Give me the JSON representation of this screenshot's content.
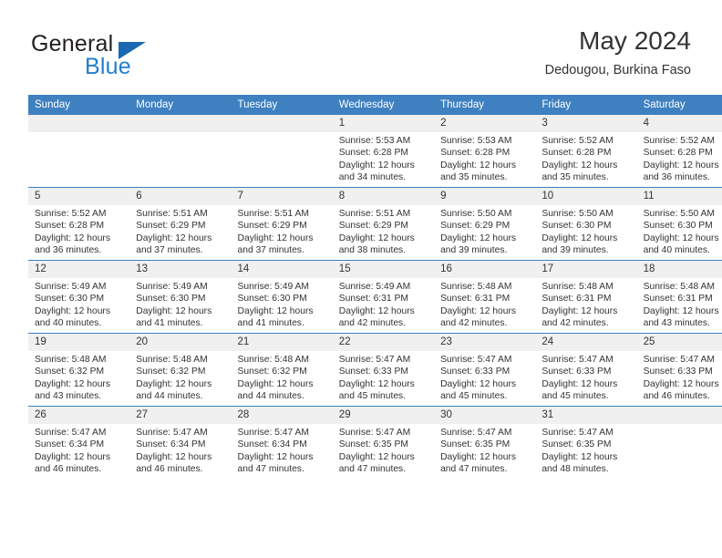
{
  "brand": {
    "name_part1": "General",
    "name_part2": "Blue",
    "triangle_color": "#1b68b3",
    "blue_text_color": "#1f7fd0"
  },
  "header": {
    "title": "May 2024",
    "subtitle": "Dedougou, Burkina Faso"
  },
  "theme": {
    "header_bar_color": "#3f80c0",
    "daynum_strip_color": "#f0f0f0",
    "text_color": "#333333"
  },
  "weekday_headers": [
    "Sunday",
    "Monday",
    "Tuesday",
    "Wednesday",
    "Thursday",
    "Friday",
    "Saturday"
  ],
  "weeks": [
    [
      {
        "day": "",
        "blank": true
      },
      {
        "day": "",
        "blank": true
      },
      {
        "day": "",
        "blank": true
      },
      {
        "day": "1",
        "sunrise": "Sunrise: 5:53 AM",
        "sunset": "Sunset: 6:28 PM",
        "daylight_line1": "Daylight: 12 hours",
        "daylight_line2": "and 34 minutes."
      },
      {
        "day": "2",
        "sunrise": "Sunrise: 5:53 AM",
        "sunset": "Sunset: 6:28 PM",
        "daylight_line1": "Daylight: 12 hours",
        "daylight_line2": "and 35 minutes."
      },
      {
        "day": "3",
        "sunrise": "Sunrise: 5:52 AM",
        "sunset": "Sunset: 6:28 PM",
        "daylight_line1": "Daylight: 12 hours",
        "daylight_line2": "and 35 minutes."
      },
      {
        "day": "4",
        "sunrise": "Sunrise: 5:52 AM",
        "sunset": "Sunset: 6:28 PM",
        "daylight_line1": "Daylight: 12 hours",
        "daylight_line2": "and 36 minutes."
      }
    ],
    [
      {
        "day": "5",
        "sunrise": "Sunrise: 5:52 AM",
        "sunset": "Sunset: 6:28 PM",
        "daylight_line1": "Daylight: 12 hours",
        "daylight_line2": "and 36 minutes."
      },
      {
        "day": "6",
        "sunrise": "Sunrise: 5:51 AM",
        "sunset": "Sunset: 6:29 PM",
        "daylight_line1": "Daylight: 12 hours",
        "daylight_line2": "and 37 minutes."
      },
      {
        "day": "7",
        "sunrise": "Sunrise: 5:51 AM",
        "sunset": "Sunset: 6:29 PM",
        "daylight_line1": "Daylight: 12 hours",
        "daylight_line2": "and 37 minutes."
      },
      {
        "day": "8",
        "sunrise": "Sunrise: 5:51 AM",
        "sunset": "Sunset: 6:29 PM",
        "daylight_line1": "Daylight: 12 hours",
        "daylight_line2": "and 38 minutes."
      },
      {
        "day": "9",
        "sunrise": "Sunrise: 5:50 AM",
        "sunset": "Sunset: 6:29 PM",
        "daylight_line1": "Daylight: 12 hours",
        "daylight_line2": "and 39 minutes."
      },
      {
        "day": "10",
        "sunrise": "Sunrise: 5:50 AM",
        "sunset": "Sunset: 6:30 PM",
        "daylight_line1": "Daylight: 12 hours",
        "daylight_line2": "and 39 minutes."
      },
      {
        "day": "11",
        "sunrise": "Sunrise: 5:50 AM",
        "sunset": "Sunset: 6:30 PM",
        "daylight_line1": "Daylight: 12 hours",
        "daylight_line2": "and 40 minutes."
      }
    ],
    [
      {
        "day": "12",
        "sunrise": "Sunrise: 5:49 AM",
        "sunset": "Sunset: 6:30 PM",
        "daylight_line1": "Daylight: 12 hours",
        "daylight_line2": "and 40 minutes."
      },
      {
        "day": "13",
        "sunrise": "Sunrise: 5:49 AM",
        "sunset": "Sunset: 6:30 PM",
        "daylight_line1": "Daylight: 12 hours",
        "daylight_line2": "and 41 minutes."
      },
      {
        "day": "14",
        "sunrise": "Sunrise: 5:49 AM",
        "sunset": "Sunset: 6:30 PM",
        "daylight_line1": "Daylight: 12 hours",
        "daylight_line2": "and 41 minutes."
      },
      {
        "day": "15",
        "sunrise": "Sunrise: 5:49 AM",
        "sunset": "Sunset: 6:31 PM",
        "daylight_line1": "Daylight: 12 hours",
        "daylight_line2": "and 42 minutes."
      },
      {
        "day": "16",
        "sunrise": "Sunrise: 5:48 AM",
        "sunset": "Sunset: 6:31 PM",
        "daylight_line1": "Daylight: 12 hours",
        "daylight_line2": "and 42 minutes."
      },
      {
        "day": "17",
        "sunrise": "Sunrise: 5:48 AM",
        "sunset": "Sunset: 6:31 PM",
        "daylight_line1": "Daylight: 12 hours",
        "daylight_line2": "and 42 minutes."
      },
      {
        "day": "18",
        "sunrise": "Sunrise: 5:48 AM",
        "sunset": "Sunset: 6:31 PM",
        "daylight_line1": "Daylight: 12 hours",
        "daylight_line2": "and 43 minutes."
      }
    ],
    [
      {
        "day": "19",
        "sunrise": "Sunrise: 5:48 AM",
        "sunset": "Sunset: 6:32 PM",
        "daylight_line1": "Daylight: 12 hours",
        "daylight_line2": "and 43 minutes."
      },
      {
        "day": "20",
        "sunrise": "Sunrise: 5:48 AM",
        "sunset": "Sunset: 6:32 PM",
        "daylight_line1": "Daylight: 12 hours",
        "daylight_line2": "and 44 minutes."
      },
      {
        "day": "21",
        "sunrise": "Sunrise: 5:48 AM",
        "sunset": "Sunset: 6:32 PM",
        "daylight_line1": "Daylight: 12 hours",
        "daylight_line2": "and 44 minutes."
      },
      {
        "day": "22",
        "sunrise": "Sunrise: 5:47 AM",
        "sunset": "Sunset: 6:33 PM",
        "daylight_line1": "Daylight: 12 hours",
        "daylight_line2": "and 45 minutes."
      },
      {
        "day": "23",
        "sunrise": "Sunrise: 5:47 AM",
        "sunset": "Sunset: 6:33 PM",
        "daylight_line1": "Daylight: 12 hours",
        "daylight_line2": "and 45 minutes."
      },
      {
        "day": "24",
        "sunrise": "Sunrise: 5:47 AM",
        "sunset": "Sunset: 6:33 PM",
        "daylight_line1": "Daylight: 12 hours",
        "daylight_line2": "and 45 minutes."
      },
      {
        "day": "25",
        "sunrise": "Sunrise: 5:47 AM",
        "sunset": "Sunset: 6:33 PM",
        "daylight_line1": "Daylight: 12 hours",
        "daylight_line2": "and 46 minutes."
      }
    ],
    [
      {
        "day": "26",
        "sunrise": "Sunrise: 5:47 AM",
        "sunset": "Sunset: 6:34 PM",
        "daylight_line1": "Daylight: 12 hours",
        "daylight_line2": "and 46 minutes."
      },
      {
        "day": "27",
        "sunrise": "Sunrise: 5:47 AM",
        "sunset": "Sunset: 6:34 PM",
        "daylight_line1": "Daylight: 12 hours",
        "daylight_line2": "and 46 minutes."
      },
      {
        "day": "28",
        "sunrise": "Sunrise: 5:47 AM",
        "sunset": "Sunset: 6:34 PM",
        "daylight_line1": "Daylight: 12 hours",
        "daylight_line2": "and 47 minutes."
      },
      {
        "day": "29",
        "sunrise": "Sunrise: 5:47 AM",
        "sunset": "Sunset: 6:35 PM",
        "daylight_line1": "Daylight: 12 hours",
        "daylight_line2": "and 47 minutes."
      },
      {
        "day": "30",
        "sunrise": "Sunrise: 5:47 AM",
        "sunset": "Sunset: 6:35 PM",
        "daylight_line1": "Daylight: 12 hours",
        "daylight_line2": "and 47 minutes."
      },
      {
        "day": "31",
        "sunrise": "Sunrise: 5:47 AM",
        "sunset": "Sunset: 6:35 PM",
        "daylight_line1": "Daylight: 12 hours",
        "daylight_line2": "and 48 minutes."
      },
      {
        "day": "",
        "blank": true
      }
    ]
  ]
}
